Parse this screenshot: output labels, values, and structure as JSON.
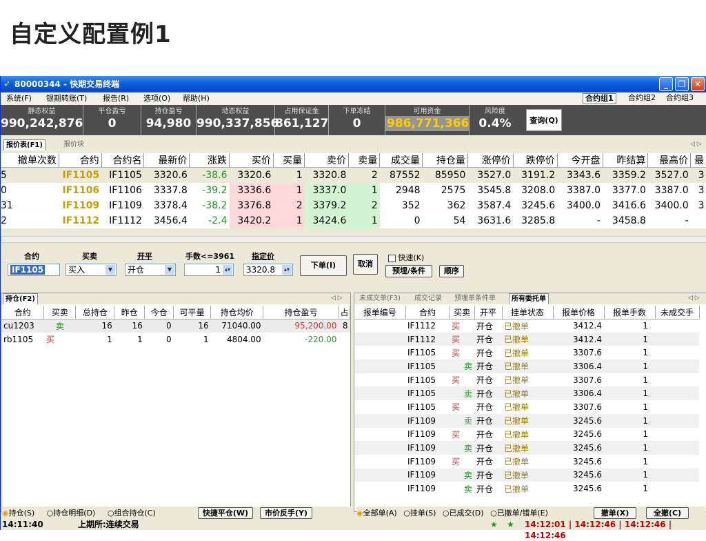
{
  "slide_title": "自定义配置例1",
  "window": {
    "title": "80000344 - 快期交易终端"
  },
  "menu": [
    "系统(F)",
    "银期转账(T)",
    "报告(R)",
    "选项(O)",
    "帮助(H)"
  ],
  "contract_groups": [
    "合约组1",
    "合约组2",
    "合约组3"
  ],
  "account": [
    {
      "label": "静态权益",
      "value": "990,242,876"
    },
    {
      "label": "平仓盈亏",
      "value": "0"
    },
    {
      "label": "持仓盈亏",
      "value": "94,980"
    },
    {
      "label": "动态权益",
      "value": "990,337,856"
    },
    {
      "label": "占用保证金",
      "value": "861,127"
    },
    {
      "label": "下单冻结",
      "value": "0"
    },
    {
      "label": "可用资金",
      "value": "986,771,366"
    },
    {
      "label": "风险度",
      "value": "0.4%"
    }
  ],
  "query_button": "查询(Q)",
  "quote_tabs": [
    "报价表(F1)",
    "报价块"
  ],
  "quote_headers": [
    "撤单次数",
    "合约",
    "合约名",
    "最新价",
    "涨跌",
    "买价",
    "买量",
    "卖价",
    "卖量",
    "成交量",
    "持仓量",
    "涨停价",
    "跌停价",
    "今开盘",
    "昨结算",
    "最高价",
    "最"
  ],
  "quotes": [
    [
      "5",
      "IF1105",
      "IF1105",
      "3320.6",
      "-38.6",
      "3320.6",
      "1",
      "3320.8",
      "2",
      "87552",
      "85950",
      "3527.0",
      "3191.2",
      "3343.6",
      "3359.2",
      "3527.0",
      "3"
    ],
    [
      "0",
      "IF1106",
      "IF1106",
      "3337.8",
      "-39.2",
      "3336.6",
      "1",
      "3337.0",
      "1",
      "2948",
      "2575",
      "3545.8",
      "3208.0",
      "3387.0",
      "3377.0",
      "3387.0",
      "3"
    ],
    [
      "31",
      "IF1109",
      "IF1109",
      "3378.4",
      "-38.2",
      "3376.8",
      "2",
      "3379.2",
      "2",
      "352",
      "362",
      "3587.4",
      "3245.6",
      "3400.0",
      "3416.6",
      "3400.0",
      "3"
    ],
    [
      "2",
      "IF1112",
      "IF1112",
      "3456.4",
      "-2.4",
      "3420.2",
      "1",
      "3424.6",
      "1",
      "0",
      "54",
      "3631.6",
      "3285.8",
      "-",
      "3458.8",
      "-",
      ""
    ]
  ],
  "order_form": {
    "labels": {
      "contract": "合约",
      "side": "买卖",
      "offset": "开平",
      "qty": "手数<=3961",
      "price": "指定价"
    },
    "contract": "IF1105",
    "side": "买入",
    "offset": "开仓",
    "qty": "1",
    "price": "3320.8",
    "submit": "下单(I)",
    "cancel": "取消",
    "fast_checkbox": "快速(K)",
    "preset_button": "预埋/条件",
    "sequence_button": "顺序"
  },
  "position_tabs": [
    "持仓(F2)"
  ],
  "position_headers": [
    "合约",
    "买卖",
    "总持仓",
    "昨仓",
    "今仓",
    "可平量",
    "持仓均价",
    "持仓盈亏",
    "占"
  ],
  "positions": [
    [
      "cu1203",
      "卖",
      "16",
      "16",
      "0",
      "16",
      "71040.00",
      "95,200.00",
      "8"
    ],
    [
      "rb1105",
      "买",
      "1",
      "1",
      "0",
      "1",
      "4804.00",
      "-220.00",
      ""
    ]
  ],
  "position_radios": [
    "持仓(S)",
    "持仓明细(D)",
    "组合持仓(C)"
  ],
  "position_buttons": [
    "快捷平仓(W)",
    "市价反手(Y)"
  ],
  "order_tabs": [
    "未成交单(F3)",
    "成交记录",
    "预埋单条件单",
    "所有委托单"
  ],
  "order_headers": [
    "报单编号",
    "合约",
    "买卖",
    "开平",
    "挂单状态",
    "报单价格",
    "报单手数",
    "未成交手"
  ],
  "orders": [
    [
      "",
      "IF1112",
      "买",
      "开仓",
      "已撤单",
      "3412.4",
      "1",
      ""
    ],
    [
      "",
      "IF1112",
      "买",
      "开仓",
      "已撤单",
      "3412.4",
      "1",
      ""
    ],
    [
      "",
      "IF1105",
      "买",
      "开仓",
      "已撤单",
      "3307.6",
      "1",
      ""
    ],
    [
      "",
      "IF1105",
      "卖",
      "开仓",
      "已撤单",
      "3306.4",
      "1",
      ""
    ],
    [
      "",
      "IF1105",
      "买",
      "开仓",
      "已撤单",
      "3307.6",
      "1",
      ""
    ],
    [
      "",
      "IF1105",
      "卖",
      "开仓",
      "已撤单",
      "3306.4",
      "1",
      ""
    ],
    [
      "",
      "IF1105",
      "买",
      "开仓",
      "已撤单",
      "3307.6",
      "1",
      ""
    ],
    [
      "",
      "IF1109",
      "卖",
      "开仓",
      "已撤单",
      "3245.6",
      "1",
      ""
    ],
    [
      "",
      "IF1109",
      "买",
      "开仓",
      "已撤单",
      "3245.6",
      "1",
      ""
    ],
    [
      "",
      "IF1109",
      "卖",
      "开仓",
      "已撤单",
      "3245.6",
      "1",
      ""
    ],
    [
      "",
      "IF1109",
      "买",
      "开仓",
      "已撤单",
      "3245.6",
      "1",
      ""
    ],
    [
      "",
      "IF1109",
      "卖",
      "开仓",
      "已撤单",
      "3245.6",
      "1",
      ""
    ],
    [
      "",
      "IF1109",
      "卖",
      "开仓",
      "已撤单",
      "3245.6",
      "1",
      ""
    ]
  ],
  "order_radios": [
    "全部单(A)",
    "挂单(S)",
    "已成交(D)",
    "已撤单/错单(E)"
  ],
  "order_buttons": [
    "撤单(X)",
    "全撤(C)"
  ],
  "status": {
    "time": "14:11:40",
    "exchange": "上期所:连续交易",
    "times": "14:12:01 | 14:12:46 | 14:12:46 | 14:12:46"
  },
  "colors": {
    "code": "#c8a000",
    "down": "#1a9a1a",
    "buy": "#d93030",
    "sell": "#2a9a2a",
    "cancelled": "#a08000"
  }
}
